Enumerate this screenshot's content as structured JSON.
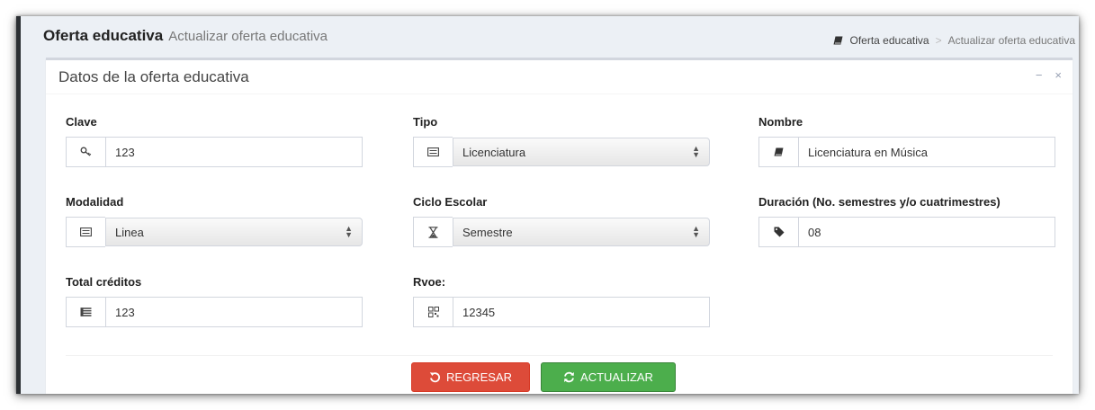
{
  "header": {
    "title": "Oferta educativa",
    "subtitle": "Actualizar oferta educativa"
  },
  "breadcrumb": {
    "items": [
      {
        "label": "Oferta educativa",
        "icon": "book-icon"
      },
      {
        "label": "Actualizar oferta educativa"
      }
    ],
    "separator": ">"
  },
  "box": {
    "title": "Datos de la oferta educativa",
    "tools": {
      "collapse": "−",
      "close": "×"
    }
  },
  "form": {
    "clave": {
      "label": "Clave",
      "value": "123",
      "icon": "key-icon"
    },
    "tipo": {
      "label": "Tipo",
      "value": "Licenciatura",
      "icon": "list-icon"
    },
    "nombre": {
      "label": "Nombre",
      "value": "Licenciatura en Música",
      "icon": "book-icon"
    },
    "modalidad": {
      "label": "Modalidad",
      "value": "Linea",
      "icon": "list-icon"
    },
    "ciclo": {
      "label": "Ciclo Escolar",
      "value": "Semestre",
      "icon": "hourglass-icon"
    },
    "duracion": {
      "label": "Duración (No. semestres y/o cuatrimestres)",
      "value": "08",
      "icon": "tag-icon"
    },
    "creditos": {
      "label": "Total créditos",
      "value": "123",
      "icon": "list-alt-icon"
    },
    "rvoe": {
      "label": "Rvoe:",
      "value": "12345",
      "icon": "qrcode-icon"
    }
  },
  "buttons": {
    "back": "REGRESAR",
    "update": "ACTUALIZAR"
  },
  "colors": {
    "back_button": "#dd4b39",
    "update_button": "#4cae4c",
    "box_border": "#d2d6de",
    "page_background": "#ecf0f5"
  }
}
